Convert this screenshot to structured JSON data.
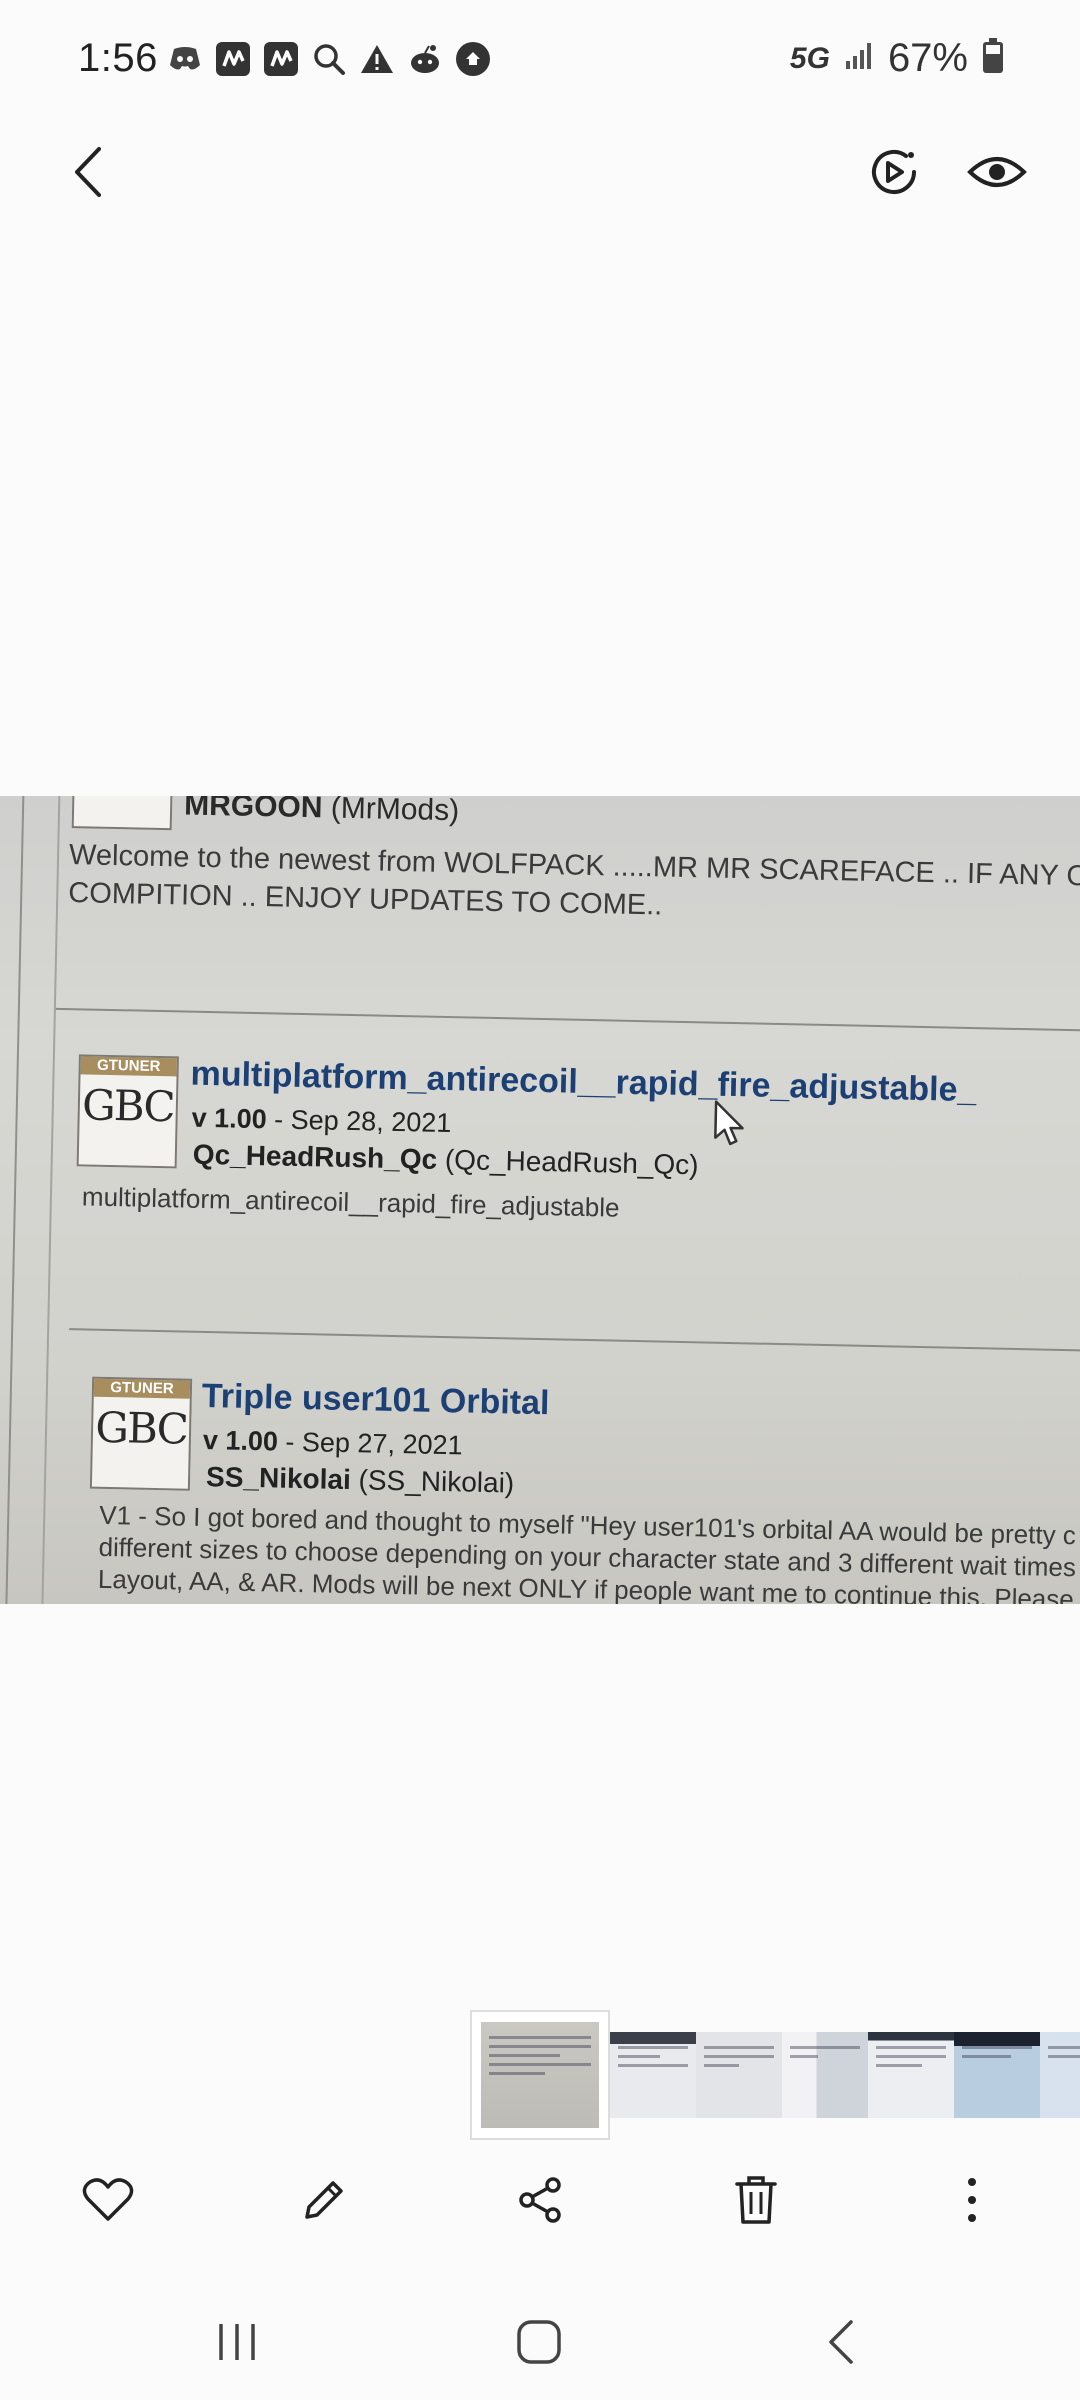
{
  "status_bar": {
    "time": "1:56",
    "network": "5G",
    "battery": "67%",
    "notification_icons": [
      "discord-icon",
      "n-app-icon",
      "n-app-icon",
      "search-icon",
      "warning-icon",
      "reddit-icon",
      "app-badge-icon"
    ]
  },
  "photo": {
    "top_entry": {
      "author_name": "MRGOON",
      "author_handle": "(MrMods)",
      "description": "Welcome to the newest from WOLFPACK .....MR MR SCAREFACE .. IF ANY O\nCOMPITION .. ENJOY UPDATES TO COME.."
    },
    "entries": [
      {
        "logo_band": "GTUNER",
        "logo_mark": "GBC",
        "title": "multiplatform_antirecoil__rapid_fire_adjustable_",
        "version": "v 1.00",
        "date": " - Sep 28, 2021",
        "author_name": "Qc_HeadRush_Qc",
        "author_handle": " (Qc_HeadRush_Qc)",
        "description": "multiplatform_antirecoil__rapid_fire_adjustable"
      },
      {
        "logo_band": "GTUNER",
        "logo_mark": "GBC",
        "title": "Triple user101 Orbital",
        "version": "v 1.00",
        "date": " - Sep 27, 2021",
        "author_name": "SS_Nikolai",
        "author_handle": " (SS_Nikolai)",
        "description": "V1 - So I got bored and thought to myself \"Hey user101's orbital AA would be pretty c\ndifferent sizes to choose depending on your character state and 3 different wait times\nLayout, AA, & AR. Mods will be next ONLY if people want me to continue this. Please"
      }
    ]
  },
  "colors": {
    "background": "#fbfbfb",
    "title_link": "#1c3f74",
    "icon": "#333333"
  }
}
